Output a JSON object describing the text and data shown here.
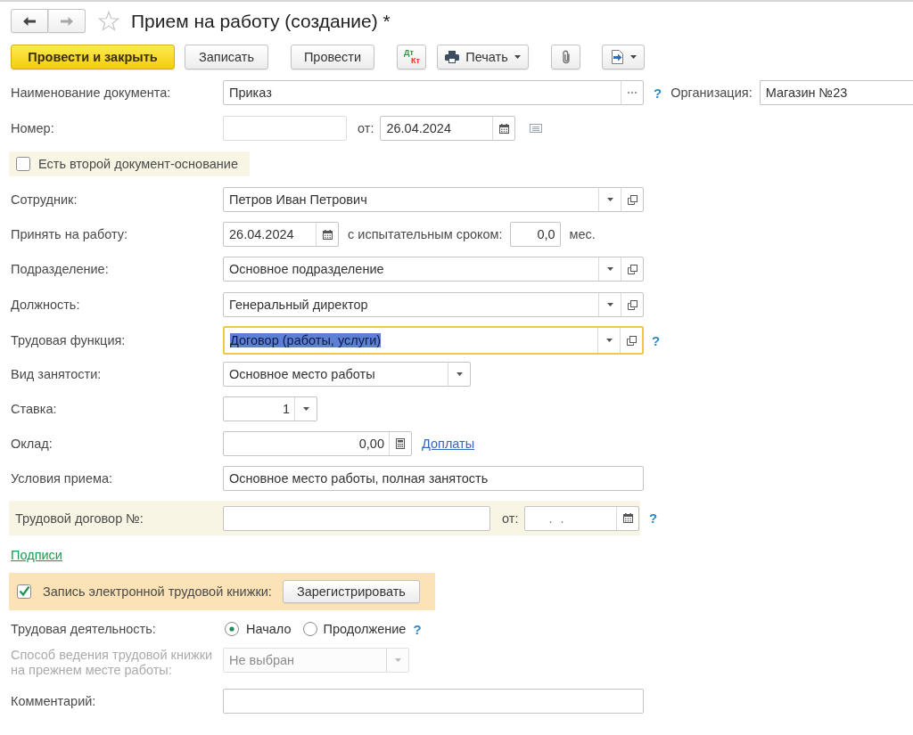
{
  "window": {
    "title": "Прием на работу (создание) *",
    "favorite": false
  },
  "navigation": [
    {
      "kind": "back",
      "disabled": false
    },
    {
      "kind": "forward",
      "disabled": true
    }
  ],
  "toolbar": [
    {
      "kind": "primary",
      "label": "Провести и закрыть"
    },
    {
      "kind": "plain",
      "label": "Записать"
    },
    {
      "kind": "plain",
      "label": "Провести"
    },
    {
      "kind": "ledger",
      "debit": "Дт",
      "credit": "Кт"
    },
    {
      "kind": "print",
      "label": "Печать"
    },
    {
      "kind": "attach"
    },
    {
      "kind": "export"
    }
  ],
  "form": {
    "document_name": {
      "label": "Наименование документа:",
      "value": "Приказ",
      "help": "?"
    },
    "organization": {
      "label": "Организация:",
      "value": "Магазин №23"
    },
    "number": {
      "label": "Номер:",
      "date_label": "от:",
      "date": "26.04.2024"
    },
    "second_basis": {
      "label": "Есть второй документ-основание",
      "checked": false
    },
    "employee": {
      "label": "Сотрудник:",
      "value": "Петров Иван Петрович"
    },
    "hire": {
      "label": "Принять на работу:",
      "date": "26.04.2024",
      "probation_label": "с испытательным сроком:",
      "probation": "0,0",
      "unit": "мес."
    },
    "department": {
      "label": "Подразделение:",
      "value": "Основное подразделение"
    },
    "position": {
      "label": "Должность:",
      "value": "Генеральный директор"
    },
    "labor_function": {
      "label": "Трудовая функция:",
      "value": "Договор (работы, услуги)",
      "focused": true,
      "help": "?"
    },
    "employment_type": {
      "label": "Вид занятости:",
      "value": "Основное место работы"
    },
    "rate": {
      "label": "Ставка:",
      "value": "1"
    },
    "salary": {
      "label": "Оклад:",
      "value": "0,00",
      "link": "Доплаты"
    },
    "conditions": {
      "label": "Условия приема:",
      "value": "Основное место работы, полная занятость"
    },
    "contract": {
      "label": "Трудовой договор №:",
      "date_label": "от:",
      "date_mask": ". .",
      "help": "?"
    },
    "signatures": {
      "link": "Подписи"
    },
    "electronic_record": {
      "label": "Запись электронной трудовой книжки:",
      "checked": true,
      "button": "Зарегистрировать"
    },
    "labor_activity": {
      "label": "Трудовая деятельность:",
      "options": [
        {
          "label": "Начало",
          "selected": true
        },
        {
          "label": "Продолжение",
          "selected": false
        }
      ],
      "help": "?"
    },
    "previous_book": {
      "label": "Способ ведения трудовой книжки на прежнем месте работы:",
      "value": "Не выбран",
      "disabled": true
    },
    "comment": {
      "label": "Комментарий:"
    }
  }
}
